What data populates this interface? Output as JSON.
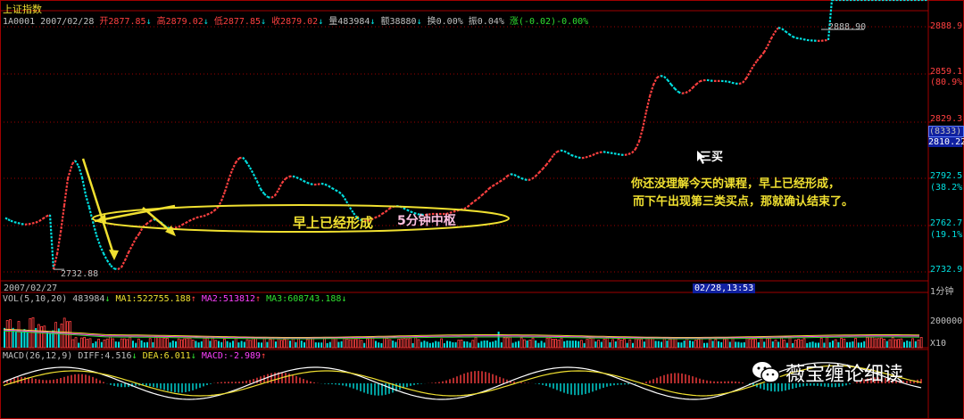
{
  "header": {
    "index_name": "上证指数",
    "code": "1A0001",
    "date": "2007/02/28",
    "open": "开2877.85",
    "high": "高2879.02",
    "low": "低2877.85",
    "close": "收2879.02",
    "volume": "量483984",
    "amount": "额38880",
    "turnover": "换0.00%",
    "amplitude": "振0.04%",
    "change": "涨(-0.02)-0.00%"
  },
  "axis": {
    "y_ticks": [
      "2888.9",
      "2859.1",
      "2829.3",
      "2792.5",
      "2762.7",
      "2732.9"
    ],
    "y_pcts": [
      "(80.9%)",
      "(38.2%)",
      "(19.1%)"
    ],
    "cursor_value": "2810.22",
    "cursor_extra": "(8333)",
    "x_left_label": "2007/02/27",
    "x_cursor_label": "02/28,13:53",
    "period_label": "1分钟"
  },
  "annotations": {
    "high_label": "2888.90",
    "low_label": "2732.88",
    "zone_label_1": "早上已经形成",
    "zone_label_2": "5分钟中枢",
    "buy_point": "三买",
    "comment_1": "你还没理解今天的课程，早上已经形成，",
    "comment_2": "而下午出现第三类买点，那就确认结束了。"
  },
  "volume_panel": {
    "title": "VOL(5,10,20)",
    "value": "483984",
    "ma1": "MA1:522755.188",
    "ma2": "MA2:513812",
    "ma3": "MA3:608743.188",
    "tick": "200000",
    "unit": "X10"
  },
  "macd_panel": {
    "title": "MACD(26,12,9)",
    "diff": "DIFF:4.516",
    "dea": "DEA:6.011",
    "macd": "MACD:-2.989"
  },
  "watermark": "薇宝缠论细读",
  "colors": {
    "up": "#ff4040",
    "down": "#00e0e0",
    "yellow": "#f0e030",
    "magenta": "#ff40ff",
    "green": "#30e030",
    "grid": "#a00000",
    "cursor_box": "#1020a0"
  },
  "chart_data": {
    "type": "line",
    "ylim": [
      2728,
      2894
    ],
    "price": {
      "x": [
        0,
        3,
        6,
        10,
        14,
        18,
        22,
        26,
        30,
        34,
        38,
        42,
        46,
        50,
        54,
        58,
        62,
        66,
        70,
        75,
        78,
        82,
        86,
        90,
        94,
        98,
        102,
        106,
        110,
        114,
        118,
        122,
        126,
        130,
        134,
        138,
        142,
        146,
        150,
        154,
        158,
        162,
        166,
        170,
        174,
        178,
        182,
        186,
        190,
        194,
        198,
        202,
        206,
        210,
        214,
        218,
        222,
        226,
        230,
        234,
        238,
        242,
        246,
        250,
        254,
        258,
        262,
        266,
        270,
        274,
        278,
        282,
        286,
        290,
        294,
        298,
        302,
        306,
        310,
        314,
        318,
        322,
        326,
        330,
        334,
        338,
        342,
        346,
        350,
        354,
        358,
        362,
        366,
        370,
        374,
        378,
        382,
        386,
        390,
        394,
        398,
        402,
        406,
        410,
        414,
        418,
        422,
        426,
        430,
        434,
        438,
        442,
        446,
        450,
        454,
        458,
        462,
        466,
        470,
        474,
        478,
        482,
        486,
        490,
        494,
        498,
        502,
        506,
        510,
        514,
        518,
        522,
        526,
        530,
        534,
        538,
        542,
        546,
        550,
        554,
        558,
        562,
        566,
        570,
        574,
        578,
        582,
        586,
        590,
        594,
        598,
        602,
        606,
        610,
        614,
        618,
        622,
        626,
        630,
        634,
        638,
        642,
        646,
        650,
        654,
        658,
        662,
        666,
        670,
        674,
        678,
        682,
        686,
        690,
        694,
        698,
        702,
        706,
        710,
        714,
        718,
        722,
        726,
        730,
        734,
        738,
        742,
        746,
        750,
        754,
        758,
        762,
        766,
        770,
        774,
        778,
        782,
        786,
        790,
        794,
        798,
        802,
        806,
        810,
        814,
        818,
        822,
        826,
        830,
        834,
        838,
        842,
        846,
        850,
        854,
        858,
        862,
        866,
        870,
        874,
        878,
        882,
        886,
        890,
        894,
        898,
        902,
        906,
        910,
        914,
        918,
        922,
        926,
        930,
        934,
        938,
        942,
        946,
        950,
        954,
        958,
        962,
        966,
        970,
        974,
        978,
        982,
        986,
        990,
        994,
        998,
        1002,
        1006,
        1010,
        1014,
        1018,
        1022,
        1026,
        1030,
        1033
      ],
      "y": [
        2768.0,
        2767.0,
        2766.2,
        2765.3,
        2764.8,
        2764.2,
        2763.8,
        2764.0,
        2764.5,
        2765.0,
        2766.0,
        2767.5,
        2769.0,
        2770.0,
        2735.3,
        2745.0,
        2758.8,
        2775.9,
        2793.0,
        2802.3,
        2804.5,
        2801.0,
        2793.7,
        2782.6,
        2774.6,
        2765.7,
        2757.1,
        2750.5,
        2745.4,
        2741.0,
        2737.7,
        2735.7,
        2735.3,
        2736.6,
        2741.0,
        2746.1,
        2750.3,
        2754.8,
        2757.9,
        2762.1,
        2764.1,
        2765.8,
        2767.2,
        2766.3,
        2765.3,
        2763.2,
        2761.7,
        2761.3,
        2761.7,
        2762.1,
        2763.6,
        2764.8,
        2766.1,
        2767.1,
        2768.1,
        2768.7,
        2769.1,
        2770.1,
        2771.0,
        2772.6,
        2774.6,
        2778.8,
        2784.7,
        2792.0,
        2798.2,
        2803.1,
        2806.0,
        2806.4,
        2803.6,
        2800.0,
        2795.8,
        2791.3,
        2786.3,
        2783.3,
        2781.2,
        2780.8,
        2782.1,
        2785.8,
        2790.3,
        2793.0,
        2794.3,
        2794.5,
        2793.7,
        2792.8,
        2791.5,
        2790.4,
        2789.6,
        2789.1,
        2789.3,
        2789.8,
        2789.3,
        2788.3,
        2786.9,
        2785.6,
        2784.4,
        2782.3,
        2778.6,
        2774.6,
        2771.1,
        2768.1,
        2766.7,
        2766.1,
        2766.1,
        2766.9,
        2768.1,
        2768.9,
        2770.5,
        2771.9,
        2773.8,
        2775.1,
        2775.5,
        2775.3,
        2774.2,
        2773.1,
        2772.0,
        2771.1,
        2770.3,
        2770.1,
        2769.9,
        2770.1,
        2770.5,
        2770.5,
        2770.5,
        2770.5,
        2770.5,
        2771.2,
        2771.9,
        2772.6,
        2773.3,
        2773.7,
        2775.1,
        2777.0,
        2778.8,
        2780.4,
        2782.5,
        2784.4,
        2786.7,
        2788.3,
        2789.6,
        2791.1,
        2792.4,
        2794.5,
        2795.8,
        2795.4,
        2794.3,
        2793.2,
        2792.4,
        2791.9,
        2792.8,
        2794.5,
        2796.8,
        2799.1,
        2801.7,
        2804.5,
        2807.9,
        2810.0,
        2810.9,
        2810.4,
        2809.3,
        2807.9,
        2807.1,
        2806.4,
        2806.0,
        2806.4,
        2807.1,
        2807.9,
        2809.0,
        2809.6,
        2810.0,
        2809.6,
        2809.3,
        2808.9,
        2808.5,
        2808.1,
        2807.9,
        2808.5,
        2809.3,
        2811.7,
        2816.5,
        2824.7,
        2835.5,
        2845.3,
        2852.5,
        2857.2,
        2858.3,
        2857.8,
        2855.6,
        2852.7,
        2850.1,
        2848.0,
        2847.1,
        2847.5,
        2848.5,
        2850.7,
        2852.9,
        2854.8,
        2855.4,
        2855.6,
        2855.2,
        2855.0,
        2855.0,
        2855.0,
        2854.8,
        2854.6,
        2853.9,
        2853.4,
        2853.2,
        2853.9,
        2856.6,
        2860.6,
        2864.5,
        2867.8,
        2870.4,
        2873.3,
        2877.3,
        2882.0,
        2885.9,
        2888.9,
        2888.2,
        2886.5,
        2884.8,
        2883.2,
        2882.3,
        2882.0,
        2881.5,
        2881.0,
        2880.8,
        2880.6,
        2880.5,
        2880.5,
        2880.8,
        2881.0
      ]
    },
    "volume": {
      "max": 250000
    },
    "macd": {}
  }
}
